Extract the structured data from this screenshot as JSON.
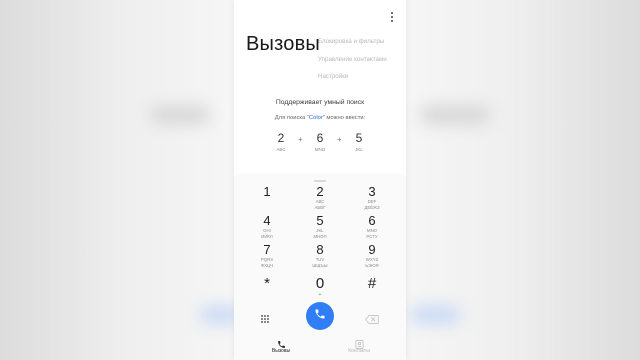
{
  "header": {
    "title": "Вызовы",
    "more_icon": "more-vert-icon"
  },
  "menu": {
    "items": [
      {
        "label": "Блокировка и фильтры"
      },
      {
        "label": "Управление контактами"
      },
      {
        "label": "Настройки"
      }
    ]
  },
  "smart_search": {
    "title": "Поддерживает умный поиск",
    "hint_prefix": "Для поиска \"",
    "hint_word": "Color",
    "hint_suffix": "\" можно ввести:",
    "example": [
      {
        "digit": "2",
        "letters": "ABC"
      },
      {
        "digit": "6",
        "letters": "MNO"
      },
      {
        "digit": "5",
        "letters": "JKL"
      }
    ],
    "plus": "+"
  },
  "keypad": {
    "keys": [
      {
        "digit": "1",
        "latin": "",
        "cyr": ""
      },
      {
        "digit": "2",
        "latin": "ABC",
        "cyr": "АБВГ"
      },
      {
        "digit": "3",
        "latin": "DEF",
        "cyr": "ДЕЁЖЗ"
      },
      {
        "digit": "4",
        "latin": "GHI",
        "cyr": "ИЙКЛ"
      },
      {
        "digit": "5",
        "latin": "JKL",
        "cyr": "МНОП"
      },
      {
        "digit": "6",
        "latin": "MNO",
        "cyr": "РСТУ"
      },
      {
        "digit": "7",
        "latin": "PQRS",
        "cyr": "ФХЦЧ"
      },
      {
        "digit": "8",
        "latin": "TUV",
        "cyr": "ШЩЪЫ"
      },
      {
        "digit": "9",
        "latin": "WXYZ",
        "cyr": "ЬЭЮЯ"
      },
      {
        "digit": "*",
        "latin": "",
        "cyr": ""
      },
      {
        "digit": "0",
        "latin": "+",
        "cyr": ""
      },
      {
        "digit": "#",
        "latin": "",
        "cyr": ""
      }
    ]
  },
  "actions": {
    "dialpad_icon": "dialpad-grid-icon",
    "call_icon": "phone-icon",
    "backspace_icon": "backspace-icon",
    "accent": "#2f7ef5"
  },
  "tabs": [
    {
      "label": "Вызовы",
      "icon": "phone-icon",
      "active": true
    },
    {
      "label": "Контакты",
      "icon": "contacts-icon",
      "active": false
    }
  ]
}
